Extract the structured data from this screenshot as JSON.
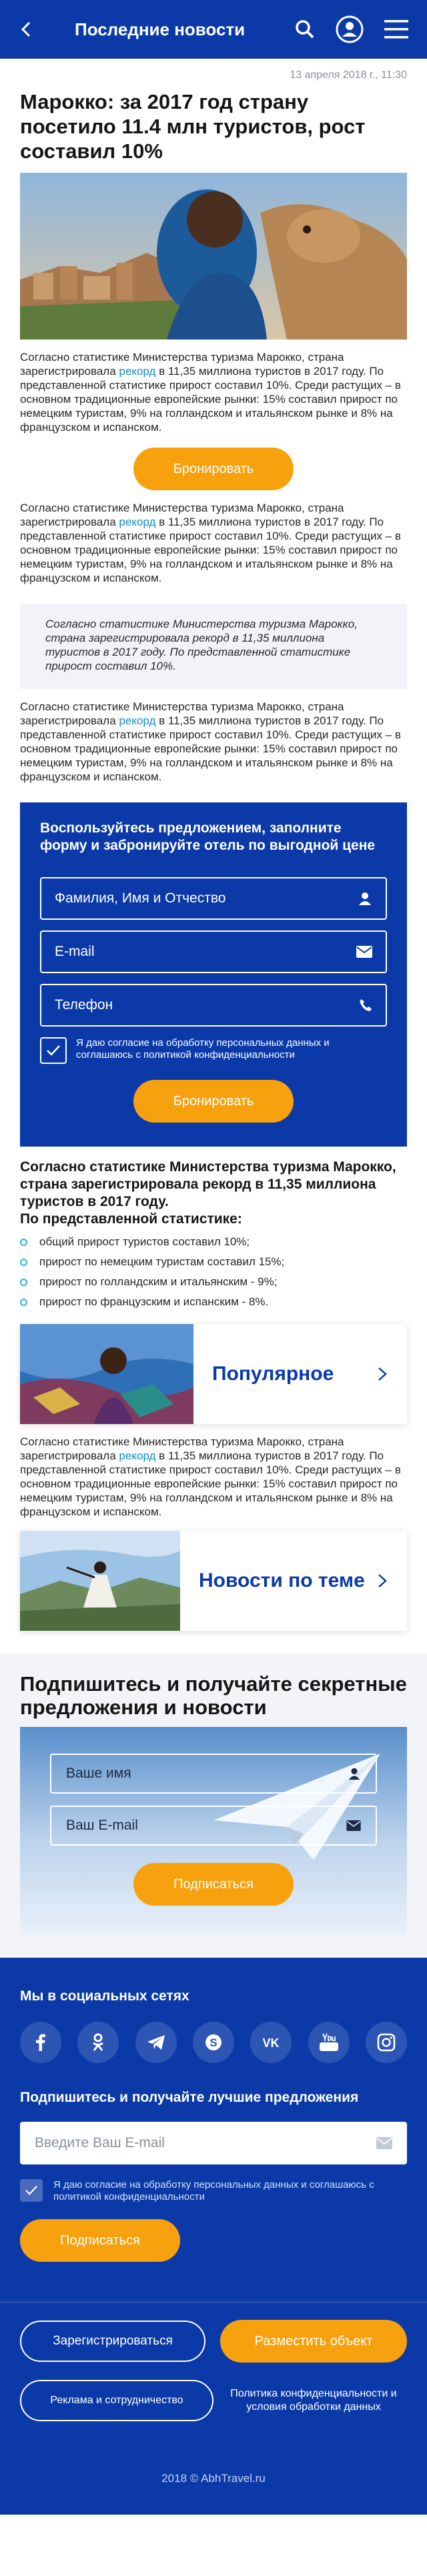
{
  "header": {
    "title": "Последние новости"
  },
  "article": {
    "date": "13 апреля 2018 г., 11:30",
    "title": "Марокко: за 2017 год страну посетило 11.4 млн туристов, рост составил 10%",
    "p_before": "Согласно статистике Министерства туризма Марокко, страна зарегистрировала",
    "p_link": "рекорд",
    "p_after": "в 11,35 миллиона туристов в 2017 году. По представленной статистике прирост составил 10%. Среди растущих – в основном традиционные европейские рынки: 15% составил прирост по немецким туристам, 9% на голландском и итальянском рынке и 8% на французском и испанском.",
    "book_button": "Бронировать",
    "quote": "Согласно статистике Министерства туризма Марокко, страна зарегистрировала рекорд в 11,35 миллиона туристов в 2017 году. По представленной статистике прирост составил 10%."
  },
  "booking_form": {
    "title": "Воспользуйтесь предложением, заполните форму и забронируйте отель по выгодной цене",
    "name_placeholder": "Фамилия, Имя и Отчество",
    "email_placeholder": "E-mail",
    "phone_placeholder": "Телефон",
    "agree_text": "Я даю согласие на обработку персональных данных и соглашаюсь с политикой конфиденциальности",
    "submit": "Бронировать"
  },
  "stats": {
    "title_1": "Согласно статистике Министерства туризма Марокко, страна зарегистрировала рекорд в 11,35 миллиона туристов в 2017 году.",
    "title_2": "По представленной статистике:",
    "items": [
      "общий прирост туристов составил 10%;",
      "прирост по немецким туристам составил 15%;",
      "прирост по голландским и итальянским - 9%;",
      "прирост по французским и испанским - 8%."
    ]
  },
  "promo": {
    "popular": "Популярное",
    "topic_news": "Новости по теме"
  },
  "subscribe": {
    "title": "Подпишитесь и получайте секретные предложения и новости",
    "name_placeholder": "Ваше имя",
    "email_placeholder": "Ваш E-mail",
    "submit": "Подписаться"
  },
  "footer": {
    "socials_title": "Мы в социальных сетях",
    "subscribe_title": "Подпишитесь и получайте лучшие предложения",
    "email_placeholder": "Введите Ваш E-mail",
    "agree_text": "Я даю согласие на обработку персональных данных и соглашаюсь с политикой конфиденциальности",
    "subscribe_button": "Подписаться",
    "register": "Зарегистрироваться",
    "place_object": "Разместить объект",
    "ads": "Реклама и сотрудничество",
    "privacy": "Политика конфиденциальности и условия обработки данных",
    "copyright": "2018 © AbhTravel.ru"
  },
  "colors": {
    "brand_blue": "#0b3aa8",
    "accent_orange": "#f8a10e",
    "link_blue": "#0b8fd6"
  }
}
